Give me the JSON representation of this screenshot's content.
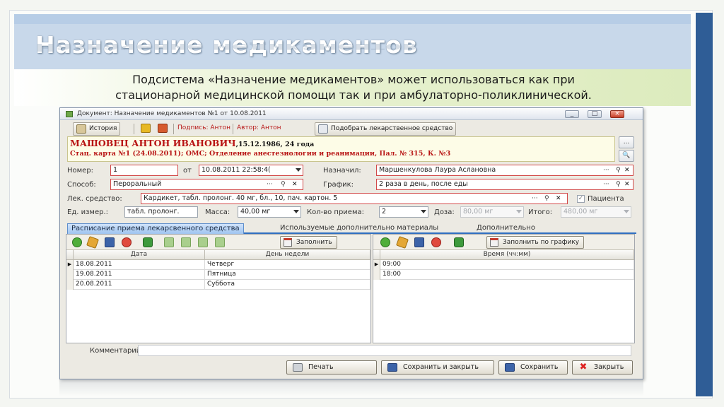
{
  "slide": {
    "title": "Назначение медикаментов",
    "subtitle_line1": "Подсистема «Назначение медикаментов» может использоваться как при",
    "subtitle_line2": "стационарной медицинской помощи так и при амбулаторно-поликлинической."
  },
  "window": {
    "title": "Документ: Назначение медикаментов №1 от 10.08.2011",
    "controls": [
      "_",
      "□",
      "×"
    ]
  },
  "toolbar": {
    "history_label": "История",
    "signature_label": "Подпись: Антон",
    "author_label": "Автор: Антон",
    "pick_drug_label": "Подобрать лекарственное средство"
  },
  "patient": {
    "name": "МАШОВЕЦ АНТОН ИВАНОВИЧ",
    "dob": ",15.12.1986, 24 года",
    "card": "Стац. карта №1 (24.08.2011); ОМС; Отделение анестезиологии и реанимации, Пал. № 315, К. №3",
    "more_btn": "...",
    "search_btn": "🔍"
  },
  "form": {
    "number_label": "Номер:",
    "number_value": "1",
    "from_label": "от",
    "date_value": "10.08.2011 22:58:4(",
    "assigned_by_label": "Назначил:",
    "assigned_by_value": "Маршенкулова Лаура Аслановна",
    "method_label": "Способ:",
    "method_value": "Пероральный",
    "schedule_label": "График:",
    "schedule_value": "2 раза в день, после еды",
    "drug_label": "Лек. средство:",
    "drug_value": "Кардикет, табл. пролонг. 40 мг, бл., 10, пач. картон. 5",
    "patient_check_label": "Пациента",
    "unit_label": "Ед. измер.:",
    "unit_value": "табл. пролонг.",
    "mass_label": "Масса:",
    "mass_value": "40,00 мг",
    "doses_label": "Кол-во приема:",
    "doses_value": "2",
    "dose_label": "Доза:",
    "dose_value": "80,00 мг",
    "total_label": "Итого:",
    "total_value": "480,00 мг",
    "lookup_icon": "···",
    "clear_icon": "✕"
  },
  "tabs": [
    {
      "label": "Расписание приема лекарсвенного средства",
      "active": true
    },
    {
      "label": "Используемые дополнительно материалы",
      "active": false
    },
    {
      "label": "Дополнительно",
      "active": false
    }
  ],
  "left_pane": {
    "fill_button": "Заполнить",
    "columns": [
      "Дата",
      "День недели"
    ],
    "rows": [
      {
        "date": "18.08.2011",
        "day": "Четверг"
      },
      {
        "date": "19.08.2011",
        "day": "Пятница"
      },
      {
        "date": "20.08.2011",
        "day": "Суббота"
      }
    ]
  },
  "right_pane": {
    "fill_button": "Заполнить по графику",
    "columns": [
      "Время (чч:мм)"
    ],
    "rows": [
      {
        "time": "09:00"
      },
      {
        "time": "18:00"
      }
    ]
  },
  "footer": {
    "comment_label": "Комментарий:",
    "comment_value": "",
    "print_button": "Печать",
    "save_close_button": "Сохранить и закрыть",
    "save_button": "Сохранить",
    "close_button": "Закрыть"
  },
  "colors": {
    "accent_blue": "#2f5d96",
    "required_border": "#d24a4a",
    "patient_text": "#b81414"
  }
}
